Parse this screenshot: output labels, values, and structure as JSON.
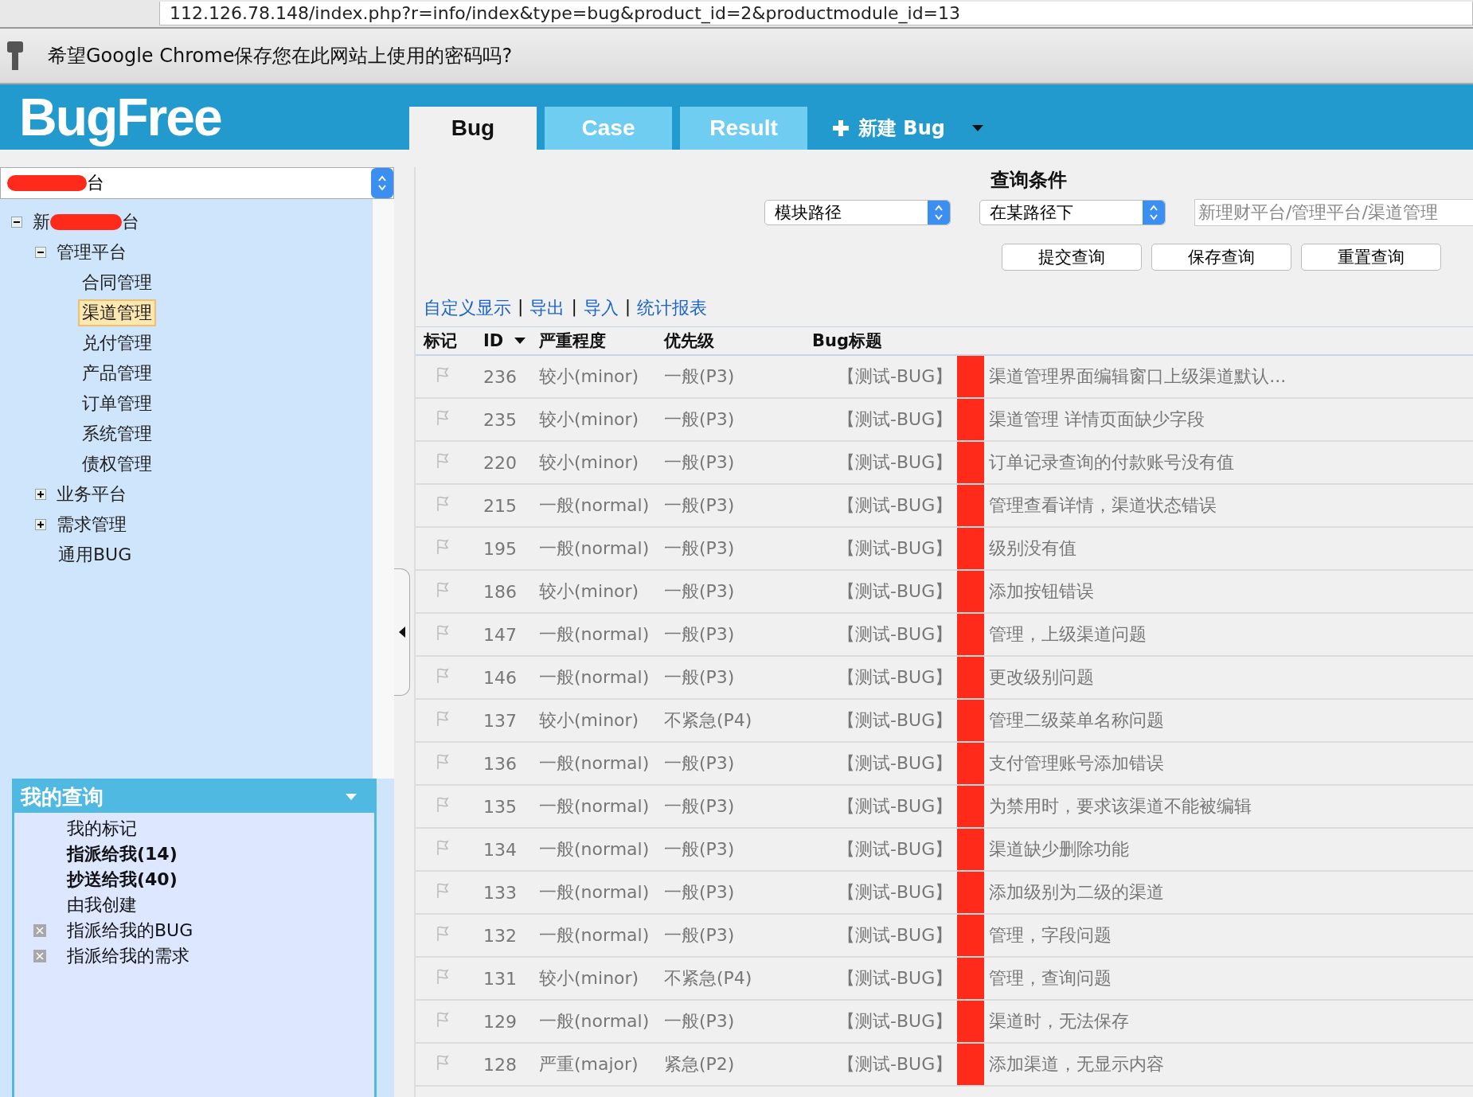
{
  "browser": {
    "url": "112.126.78.148/index.php?r=info/index&type=bug&product_id=2&productmodule_id=13",
    "password_prompt": "希望Google Chrome保存您在此网站上使用的密码吗?"
  },
  "header": {
    "logo": "BugFree",
    "tabs": [
      {
        "label": "Bug",
        "selected": true
      },
      {
        "label": "Case",
        "selected": false
      },
      {
        "label": "Result",
        "selected": false
      }
    ],
    "new_button": "新建 Bug"
  },
  "product_select": {
    "visible_text": "台"
  },
  "tree": [
    {
      "label_parts": [
        "新",
        "台"
      ],
      "expanded": true,
      "selected": false,
      "children": [
        {
          "label": "管理平台",
          "expanded": true,
          "selected": false,
          "children": [
            {
              "label": "合同管理",
              "selected": false
            },
            {
              "label": "渠道管理",
              "selected": true
            },
            {
              "label": "兑付管理",
              "selected": false
            },
            {
              "label": "产品管理",
              "selected": false
            },
            {
              "label": "订单管理",
              "selected": false
            },
            {
              "label": "系统管理",
              "selected": false
            },
            {
              "label": "债权管理",
              "selected": false
            }
          ]
        },
        {
          "label": "业务平台",
          "expanded": false,
          "selected": false
        },
        {
          "label": "需求管理",
          "expanded": false,
          "selected": false
        },
        {
          "label": "通用BUG",
          "selected": false
        }
      ]
    }
  ],
  "my_queries": {
    "title": "我的查询",
    "items": [
      {
        "label": "我的标记",
        "bold": false,
        "removable": false
      },
      {
        "label": "指派给我(14)",
        "bold": true,
        "removable": false
      },
      {
        "label": "抄送给我(40)",
        "bold": true,
        "removable": false
      },
      {
        "label": "由我创建",
        "bold": false,
        "removable": false
      },
      {
        "label": "指派给我的BUG",
        "bold": false,
        "removable": true
      },
      {
        "label": "指派给我的需求",
        "bold": false,
        "removable": true
      }
    ]
  },
  "query": {
    "title": "查询条件",
    "field": "模块路径",
    "operator": "在某路径下",
    "value": "新理财平台/管理平台/渠道管理",
    "buttons": [
      "提交查询",
      "保存查询",
      "重置查询"
    ]
  },
  "links": [
    {
      "kind": "link",
      "text": "自定义显示"
    },
    {
      "kind": "separator",
      "text": "|"
    },
    {
      "kind": "link",
      "text": "导出"
    },
    {
      "kind": "separator",
      "text": "|"
    },
    {
      "kind": "link",
      "text": "导入"
    },
    {
      "kind": "separator",
      "text": "|"
    },
    {
      "kind": "link",
      "text": "统计报表"
    }
  ],
  "table": {
    "columns": [
      {
        "label": "标记",
        "sorted": false
      },
      {
        "label": "ID",
        "sorted": true
      },
      {
        "label": "严重程度",
        "sorted": false
      },
      {
        "label": "优先级",
        "sorted": false
      },
      {
        "label": "Bug标题",
        "sorted": false
      }
    ],
    "rows": [
      {
        "id": "236",
        "severity": "较小(minor)",
        "priority": "一般(P3)",
        "title_start": "【测试-BUG】",
        "title_end": "渠道管理界面编辑窗口上级渠道默认..."
      },
      {
        "id": "235",
        "severity": "较小(minor)",
        "priority": "一般(P3)",
        "title_start": "【测试-BUG】",
        "title_end": "渠道管理 详情页面缺少字段"
      },
      {
        "id": "220",
        "severity": "较小(minor)",
        "priority": "一般(P3)",
        "title_start": "【测试-BUG】",
        "title_end": "订单记录查询的付款账号没有值"
      },
      {
        "id": "215",
        "severity": "一般(normal)",
        "priority": "一般(P3)",
        "title_start": "【测试-BUG】",
        "title_end": "管理查看详情，渠道状态错误"
      },
      {
        "id": "195",
        "severity": "一般(normal)",
        "priority": "一般(P3)",
        "title_start": "【测试-BUG】",
        "title_end": "级别没有值"
      },
      {
        "id": "186",
        "severity": "较小(minor)",
        "priority": "一般(P3)",
        "title_start": "【测试-BUG】",
        "title_end": "添加按钮错误"
      },
      {
        "id": "147",
        "severity": "一般(normal)",
        "priority": "一般(P3)",
        "title_start": "【测试-BUG】",
        "title_end": "管理，上级渠道问题"
      },
      {
        "id": "146",
        "severity": "一般(normal)",
        "priority": "一般(P3)",
        "title_start": "【测试-BUG】",
        "title_end": "更改级别问题"
      },
      {
        "id": "137",
        "severity": "较小(minor)",
        "priority": "不紧急(P4)",
        "title_start": "【测试-BUG】",
        "title_end": "管理二级菜单名称问题"
      },
      {
        "id": "136",
        "severity": "一般(normal)",
        "priority": "一般(P3)",
        "title_start": "【测试-BUG】",
        "title_end": "支付管理账号添加错误"
      },
      {
        "id": "135",
        "severity": "一般(normal)",
        "priority": "一般(P3)",
        "title_start": "【测试-BUG】",
        "title_end": "为禁用时，要求该渠道不能被编辑"
      },
      {
        "id": "134",
        "severity": "一般(normal)",
        "priority": "一般(P3)",
        "title_start": "【测试-BUG】",
        "title_end": "渠道缺少删除功能"
      },
      {
        "id": "133",
        "severity": "一般(normal)",
        "priority": "一般(P3)",
        "title_start": "【测试-BUG】",
        "title_end": "添加级别为二级的渠道"
      },
      {
        "id": "132",
        "severity": "一般(normal)",
        "priority": "一般(P3)",
        "title_start": "【测试-BUG】",
        "title_end": "管理，字段问题"
      },
      {
        "id": "131",
        "severity": "较小(minor)",
        "priority": "不紧急(P4)",
        "title_start": "【测试-BUG】",
        "title_end": "管理，查询问题"
      },
      {
        "id": "129",
        "severity": "一般(normal)",
        "priority": "一般(P3)",
        "title_start": "【测试-BUG】",
        "title_end": "渠道时，无法保存"
      },
      {
        "id": "128",
        "severity": "严重(major)",
        "priority": "紧急(P2)",
        "title_start": "【测试-BUG】",
        "title_end": "添加渠道，无显示内容"
      }
    ]
  }
}
